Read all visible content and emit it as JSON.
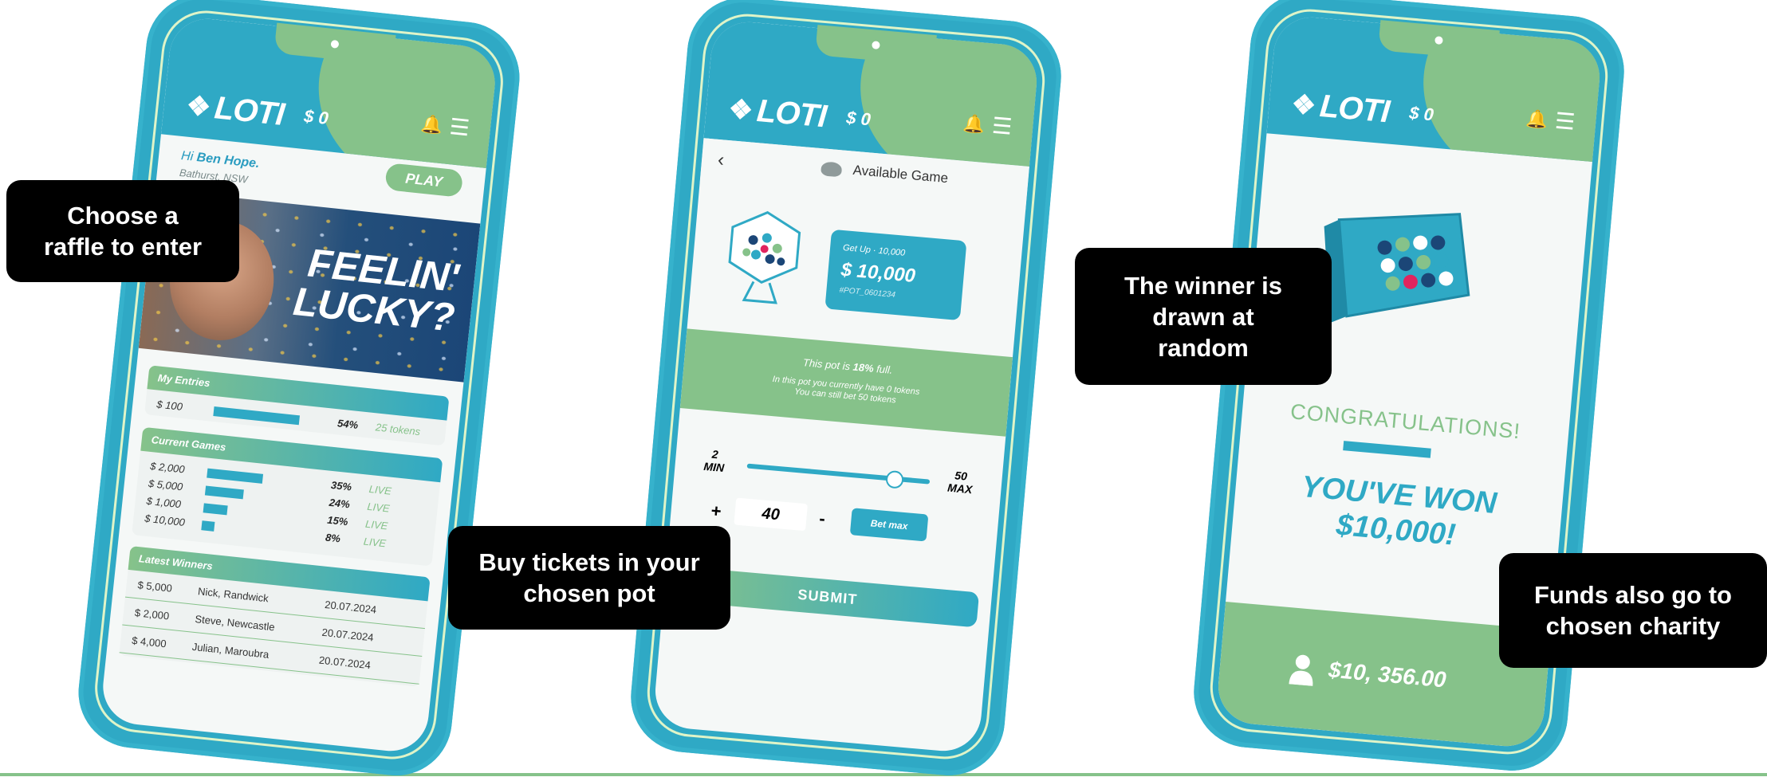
{
  "callouts": {
    "choose": "Choose a\nraffle to enter",
    "buy": "Buy tickets in your\nchosen pot",
    "winner": "The winner is\ndrawn at\nrandom",
    "funds": "Funds also go to\nchosen charity"
  },
  "app": {
    "logo": "LOTI",
    "balance": "$ 0"
  },
  "phone1": {
    "greeting_hi": "Hi",
    "greeting_name": "Ben Hope.",
    "location": "Bathurst, NSW",
    "play_label": "PLAY",
    "hero_text": "FEELIN'\nLUCKY?",
    "my_entries": {
      "title": "My Entries",
      "amount": "$ 100",
      "progress": 0.54,
      "percent": "54%",
      "tokens": "25 tokens"
    },
    "current_games": {
      "title": "Current Games",
      "rows": [
        {
          "amount": "$ 2,000",
          "progress": 0.35,
          "percent": "35%",
          "status": "LIVE"
        },
        {
          "amount": "$ 5,000",
          "progress": 0.24,
          "percent": "24%",
          "status": "LIVE"
        },
        {
          "amount": "$ 1,000",
          "progress": 0.15,
          "percent": "15%",
          "status": "LIVE"
        },
        {
          "amount": "$ 10,000",
          "progress": 0.08,
          "percent": "8%",
          "status": "LIVE"
        }
      ]
    },
    "latest_winners": {
      "title": "Latest Winners",
      "rows": [
        {
          "amount": "$ 5,000",
          "name": "Nick, Randwick",
          "date": "20.07.2024"
        },
        {
          "amount": "$ 2,000",
          "name": "Steve, Newcastle",
          "date": "20.07.2024"
        },
        {
          "amount": "$ 4,000",
          "name": "Julian, Maroubra",
          "date": "20.07.2024"
        }
      ]
    }
  },
  "phone2": {
    "header": "Available Game",
    "pot_getup": "Get Up  ·  10,000",
    "pot_value": "$ 10,000",
    "pot_id": "#POT_0601234",
    "pot_full_prefix": "This pot is",
    "pot_full_percent": "18%",
    "pot_full_suffix": "full.",
    "pot_info": "In this pot you currently have 0 tokens\nYou can still bet 50 tokens",
    "slider_min": "2\nMIN",
    "slider_max": "50\nMAX",
    "slider_level": 0.8,
    "plus": "+",
    "quantity": "40",
    "minus": "-",
    "bet_max": "Bet max",
    "submit": "SUBMIT"
  },
  "phone3": {
    "congrats": "CONGRATULATIONS!",
    "won": "YOU'VE WON\n$10,000!",
    "footer_amount": "$10, 356.00"
  },
  "colors": {
    "teal": "#2fa9c5",
    "green": "#86c28a"
  }
}
